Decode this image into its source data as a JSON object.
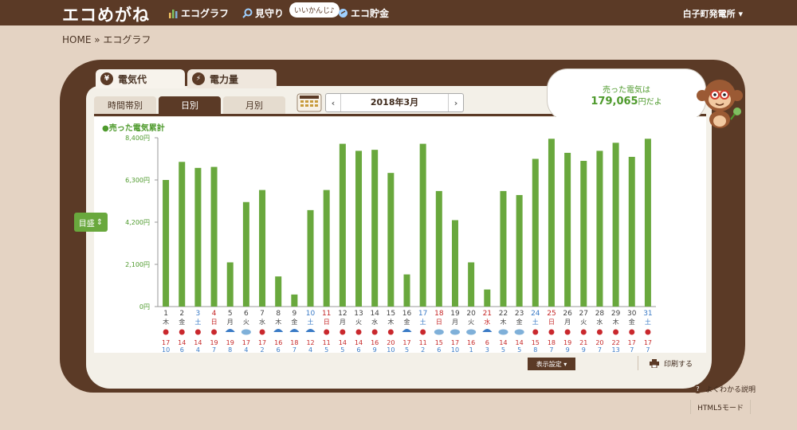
{
  "header": {
    "logo": "エコめがね",
    "nav": [
      {
        "label": "エコグラフ",
        "icon": "bar-chart-icon"
      },
      {
        "label": "見守り",
        "icon": "magnifier-icon"
      },
      {
        "label": "エコ貯金",
        "icon": "piggy-bank-icon"
      }
    ],
    "status_bubble": "いいかんじ♪",
    "plant_name": "白子町発電所",
    "plant_caret": "▾"
  },
  "breadcrumb": "HOME » エコグラフ",
  "main_tabs": [
    {
      "label": "電気代",
      "icon": "yen-icon",
      "glyph": "¥"
    },
    {
      "label": "電力量",
      "icon": "lightning-icon",
      "glyph": "⚡"
    }
  ],
  "sub_tabs": [
    "時間帯別",
    "日別",
    "月別"
  ],
  "month_nav": {
    "prev": "‹",
    "label": "2018年3月",
    "next": "›"
  },
  "summary": {
    "line1": "売った電気は",
    "amount": "179,065",
    "unit": "円だよ"
  },
  "chart_data": {
    "type": "bar",
    "legend": "●売った電気累計",
    "ylim": [
      0,
      8400
    ],
    "yticks": [
      "8,400円",
      "6,300円",
      "4,200円",
      "2,100円",
      "0円"
    ],
    "bar_color": "#69a83d",
    "categories": [
      "1",
      "2",
      "3",
      "4",
      "5",
      "6",
      "7",
      "8",
      "9",
      "10",
      "11",
      "12",
      "13",
      "14",
      "15",
      "16",
      "17",
      "18",
      "19",
      "20",
      "21",
      "22",
      "23",
      "24",
      "25",
      "26",
      "27",
      "28",
      "29",
      "30",
      "31"
    ],
    "weekdays": [
      "木",
      "金",
      "土",
      "日",
      "月",
      "火",
      "水",
      "木",
      "金",
      "土",
      "日",
      "月",
      "火",
      "水",
      "木",
      "金",
      "土",
      "日",
      "月",
      "火",
      "水",
      "木",
      "金",
      "土",
      "日",
      "月",
      "火",
      "水",
      "木",
      "金",
      "土"
    ],
    "day_colors": [
      "#444",
      "#444",
      "#3b7bc6",
      "#c62828",
      "#444",
      "#444",
      "#444",
      "#444",
      "#444",
      "#3b7bc6",
      "#c62828",
      "#444",
      "#444",
      "#444",
      "#444",
      "#444",
      "#3b7bc6",
      "#c62828",
      "#444",
      "#444",
      "#c62828",
      "#444",
      "#444",
      "#3b7bc6",
      "#c62828",
      "#444",
      "#444",
      "#444",
      "#444",
      "#444",
      "#3b7bc6"
    ],
    "values": [
      6300,
      7200,
      6900,
      6950,
      2200,
      5200,
      5800,
      1500,
      600,
      4800,
      5800,
      8100,
      7750,
      7800,
      6650,
      1600,
      8100,
      5750,
      4300,
      2200,
      850,
      5750,
      5550,
      7350,
      8350,
      7650,
      7250,
      7750,
      8150,
      7450,
      8350
    ],
    "weather": [
      "sunny",
      "sunny",
      "sunny",
      "sunny",
      "rainy",
      "cloudy",
      "sunny",
      "rainy",
      "rainy",
      "rainy",
      "sunny",
      "sunny",
      "sunny",
      "sunny",
      "sunny",
      "rainy",
      "sunny",
      "cloudy",
      "cloudy",
      "cloudy",
      "rainy",
      "cloudy",
      "cloudy",
      "sunny",
      "sunny",
      "sunny",
      "sunny",
      "sunny",
      "sunny",
      "sunny",
      "sunny"
    ],
    "temp_high": [
      "17",
      "14",
      "14",
      "19",
      "19",
      "17",
      "17",
      "16",
      "18",
      "12",
      "11",
      "14",
      "14",
      "16",
      "20",
      "17",
      "11",
      "15",
      "17",
      "16",
      "6",
      "14",
      "14",
      "15",
      "18",
      "19",
      "21",
      "20",
      "22",
      "17",
      "17"
    ],
    "temp_low": [
      "10",
      "6",
      "4",
      "7",
      "8",
      "4",
      "2",
      "6",
      "7",
      "4",
      "5",
      "5",
      "6",
      "9",
      "10",
      "5",
      "2",
      "6",
      "10",
      "1",
      "3",
      "5",
      "5",
      "8",
      "7",
      "9",
      "9",
      "7",
      "13",
      "7",
      "7"
    ],
    "weather_colors": {
      "sunny": "#c9282d",
      "cloudy": "#7fb0d9",
      "rainy": "#3b7bc6"
    },
    "high_color": "#c62828",
    "low_color": "#3b7bc6"
  },
  "unit_selector": {
    "label": "目盛",
    "caret": "⇕"
  },
  "display_settings": "表示設定 ▾",
  "print_label": "印刷する",
  "help_label": "よくわかる説明",
  "help_glyph": "?",
  "html5_label": "HTML5モード"
}
